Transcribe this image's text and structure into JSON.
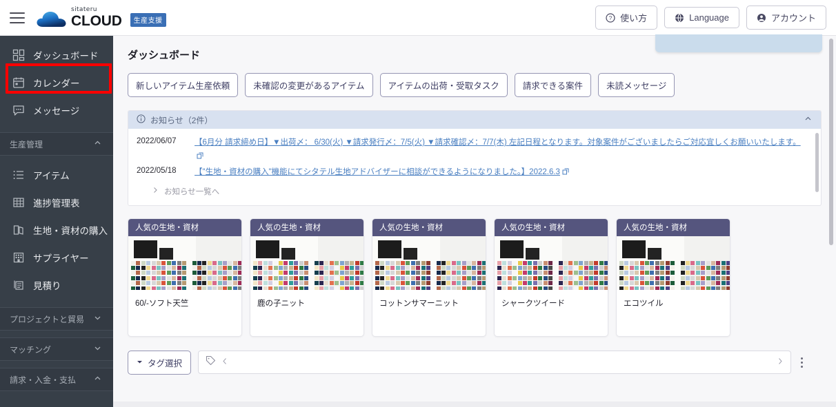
{
  "header": {
    "menu_icon": "hamburger-icon",
    "logo": {
      "brand_small": "sitateru",
      "brand_main": "CLOUD",
      "badge": "生産支援"
    },
    "buttons": [
      {
        "label": "使い方",
        "icon": "question-circle-icon"
      },
      {
        "label": "Language",
        "icon": "globe-icon"
      },
      {
        "label": "アカウント",
        "icon": "account-circle-icon"
      }
    ]
  },
  "sidebar": {
    "items": [
      {
        "label": "ダッシュボード",
        "icon": "dashboard-grid-icon"
      },
      {
        "label": "カレンダー",
        "icon": "calendar-icon"
      },
      {
        "label": "メッセージ",
        "icon": "message-bubble-icon",
        "highlighted": true
      }
    ],
    "section_production": {
      "label": "生産管理",
      "chevron": "chevron-up-icon"
    },
    "production_items": [
      {
        "label": "アイテム",
        "icon": "list-icon"
      },
      {
        "label": "進捗管理表",
        "icon": "table-grid-icon"
      },
      {
        "label": "生地・資材の購入",
        "icon": "fabric-book-icon"
      },
      {
        "label": "サプライヤー",
        "icon": "building-icon"
      },
      {
        "label": "見積り",
        "icon": "quote-document-icon"
      }
    ],
    "collapsed_sections": [
      {
        "label": "プロジェクトと貿易",
        "chevron": "chevron-down-icon"
      },
      {
        "label": "マッチング",
        "chevron": "chevron-down-icon"
      },
      {
        "label": "請求・入金・支払",
        "chevron": "chevron-up-icon"
      }
    ]
  },
  "main": {
    "page_title": "ダッシュボード",
    "filter_buttons": [
      "新しいアイテム生産依頼",
      "未確認の変更があるアイテム",
      "アイテムの出荷・受取タスク",
      "請求できる案件",
      "未読メッセージ"
    ],
    "notice": {
      "icon": "info-circle-icon",
      "title": "お知らせ（2件）",
      "collapse_icon": "chevron-up-icon",
      "rows": [
        {
          "date": "2022/06/07",
          "text": "【6月分 請求締め日】▼出荷〆： 6/30(火) ▼請求発行〆：7/5(火) ▼請求確認〆：7/7(木) 左記日程となります。対象案件がございましたらご対応宜しくお願いいたします。",
          "external_icon": "external-link-icon"
        },
        {
          "date": "2022/05/18",
          "text": "【\"生地・資材の購入\"機能にてシタテル生地アドバイザーに相談ができるようになりました。】2022.6.3",
          "external_icon": "external-link-icon"
        }
      ],
      "more_link": "お知らせ一覧へ",
      "more_icon": "chevron-right-icon"
    },
    "cards": [
      {
        "header": "人気の生地・資材",
        "title": "60/-ソフト天竺"
      },
      {
        "header": "人気の生地・資材",
        "title": "鹿の子ニット"
      },
      {
        "header": "人気の生地・資材",
        "title": "コットンサマーニット"
      },
      {
        "header": "人気の生地・資材",
        "title": "シャークツイード"
      },
      {
        "header": "人気の生地・資材",
        "title": "エコツイル"
      }
    ],
    "tagbar": {
      "select_label": "タグ選択",
      "select_icon": "caret-down-icon",
      "tag_icon": "tag-icon",
      "prev_icon": "chevron-left-icon",
      "next_icon": "chevron-right-icon",
      "menu_icon": "kebab-menu-icon",
      "input_value": ""
    }
  },
  "colors": {
    "sidebar_bg": "#373f48",
    "card_header": "#55557e",
    "notice_header": "#d8e1f0",
    "link_blue": "#4a7fc1",
    "highlight_red": "#ff0000",
    "badge_blue": "#3a6fb5"
  }
}
